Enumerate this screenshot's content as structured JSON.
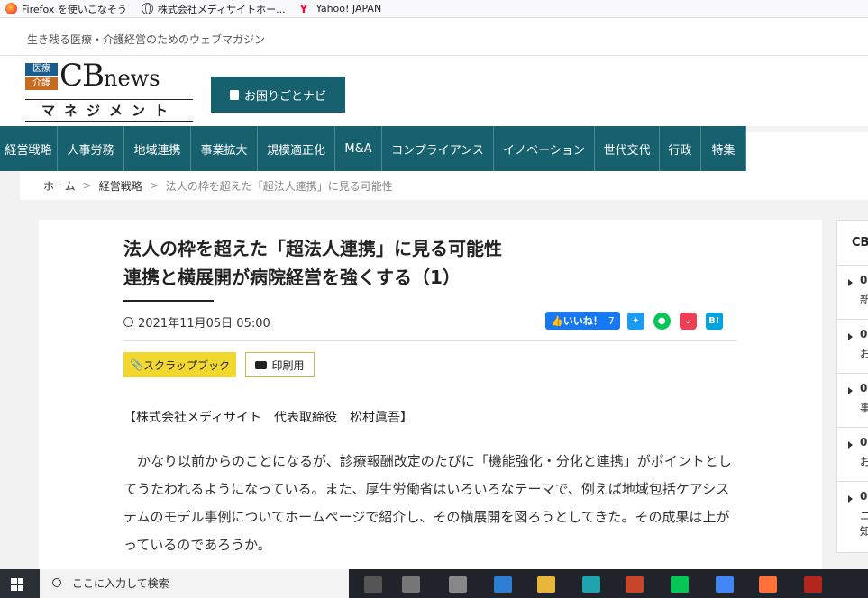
{
  "bookmarks": [
    {
      "label": "Firefox を使いこなそう",
      "icon": "firefox-icon"
    },
    {
      "label": "株式会社メディサイトホー...",
      "icon": "globe-icon"
    },
    {
      "label": "Yahoo! JAPAN",
      "icon": "yahoo-icon"
    }
  ],
  "site": {
    "tagline": "生き残る医療・介護経営のためのウェブマガジン",
    "logo_tag1": "医療",
    "logo_tag2": "介護",
    "logo_word_big": "CB",
    "logo_word_small": "news",
    "logo_sub": "マネジメント",
    "navi_button": "お困りごとナビ"
  },
  "nav": [
    "経営戦略",
    "人事労務",
    "地域連携",
    "事業拡大",
    "規模適正化",
    "M&A",
    "コンプライアンス",
    "イノベーション",
    "世代交代",
    "行政",
    "特集"
  ],
  "breadcrumb": {
    "home": "ホーム",
    "sep": ">",
    "category": "経営戦略",
    "current": "法人の枠を超えた「超法人連携」に見る可能性"
  },
  "article": {
    "title_line1": "法人の枠を超えた「超法人連携」に見る可能性",
    "title_line2": "連携と横展開が病院経営を強くする（1）",
    "date": "2021年11月05日 05:00",
    "like_label": "いいね！",
    "like_count": "7",
    "hatena_label": "B!",
    "scrap_label": "スクラップブック",
    "print_label": "印刷用",
    "author": "【株式会社メディサイト　代表取締役　松村眞吾】",
    "body": "かなり以前からのことになるが、診療報酬改定のたびに「機能強化・分化と連携」がポイントとしてうたわれるようになっている。また、厚生労働省はいろいろなテーマで、例えば地域包括ケアシステムのモデル事例についてホームページで紹介し、その横展開を図ろうとしてきた。その成果は上がっているのであろうか。"
  },
  "sidebar": {
    "head": "CB",
    "items": [
      {
        "date": "0",
        "text": "新"
      },
      {
        "date": "0",
        "text": "お"
      },
      {
        "date": "0",
        "text": "事"
      },
      {
        "date": "0",
        "text": "お"
      },
      {
        "date": "0",
        "text": "ニ"
      }
    ],
    "last_line": "知"
  },
  "taskbar": {
    "search_placeholder": "ここに入力して検索"
  },
  "colors": {
    "brand_teal": "#17606e",
    "scrap_yellow": "#f2d72e",
    "facebook": "#1877f2"
  }
}
